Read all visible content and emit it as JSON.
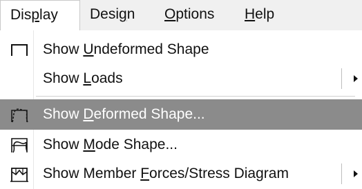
{
  "menubar": {
    "items": [
      {
        "pre": "Dis",
        "mnemonic": "p",
        "post": "lay"
      },
      {
        "pre": "Desi",
        "mnemonic": "g",
        "post": "n"
      },
      {
        "pre": "",
        "mnemonic": "O",
        "post": "ptions"
      },
      {
        "pre": "",
        "mnemonic": "H",
        "post": "elp"
      }
    ]
  },
  "display_menu": {
    "items": [
      {
        "pre": "Show ",
        "mnemonic": "U",
        "post": "ndeformed Shape",
        "icon": "undeformed-shape-icon"
      },
      {
        "pre": "Show ",
        "mnemonic": "L",
        "post": "oads",
        "has_submenu": true
      },
      {
        "pre": "Show ",
        "mnemonic": "D",
        "post": "eformed Shape...",
        "icon": "deformed-shape-icon",
        "highlighted": true
      },
      {
        "pre": "Show ",
        "mnemonic": "M",
        "post": "ode Shape...",
        "icon": "mode-shape-icon"
      },
      {
        "pre": "Show Member ",
        "mnemonic": "F",
        "post": "orces/Stress Diagram",
        "icon": "member-forces-icon",
        "has_submenu": true
      }
    ]
  },
  "colors": {
    "menubar_bg": "#f0f0f0",
    "highlight_bg": "#8b8b8b",
    "highlight_text": "#ffffff"
  }
}
